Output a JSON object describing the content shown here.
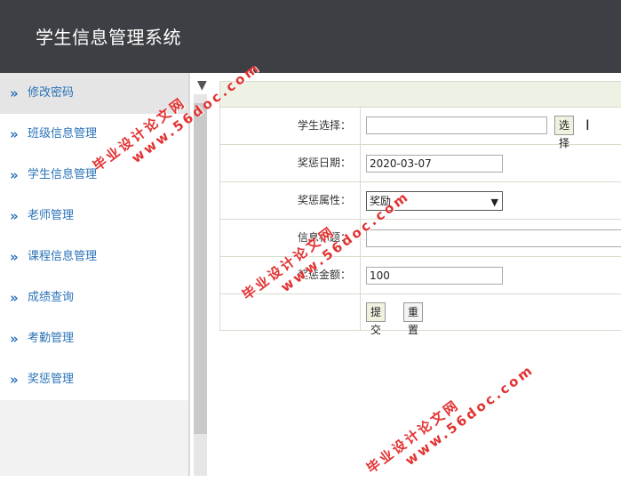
{
  "app": {
    "title": "学生信息管理系统"
  },
  "sidebar": {
    "items": [
      {
        "label": "修改密码",
        "active": true
      },
      {
        "label": "班级信息管理"
      },
      {
        "label": "学生信息管理"
      },
      {
        "label": "老师管理"
      },
      {
        "label": "课程信息管理"
      },
      {
        "label": "成绩查询"
      },
      {
        "label": "考勤管理"
      },
      {
        "label": "奖惩管理"
      }
    ]
  },
  "form": {
    "student": {
      "label": "学生选择：",
      "value": "",
      "select_button": "选择"
    },
    "date": {
      "label": "奖惩日期：",
      "value": "2020-03-07"
    },
    "type": {
      "label": "奖惩属性：",
      "value": "奖励"
    },
    "title": {
      "label": "信息标题：",
      "value": ""
    },
    "amount": {
      "label": "奖惩金额：",
      "value": "100"
    },
    "actions": {
      "submit": "提交",
      "reset": "重置"
    }
  },
  "watermarks": [
    {
      "line1": "毕业设计论文网",
      "line2": "www.56doc.com"
    }
  ]
}
